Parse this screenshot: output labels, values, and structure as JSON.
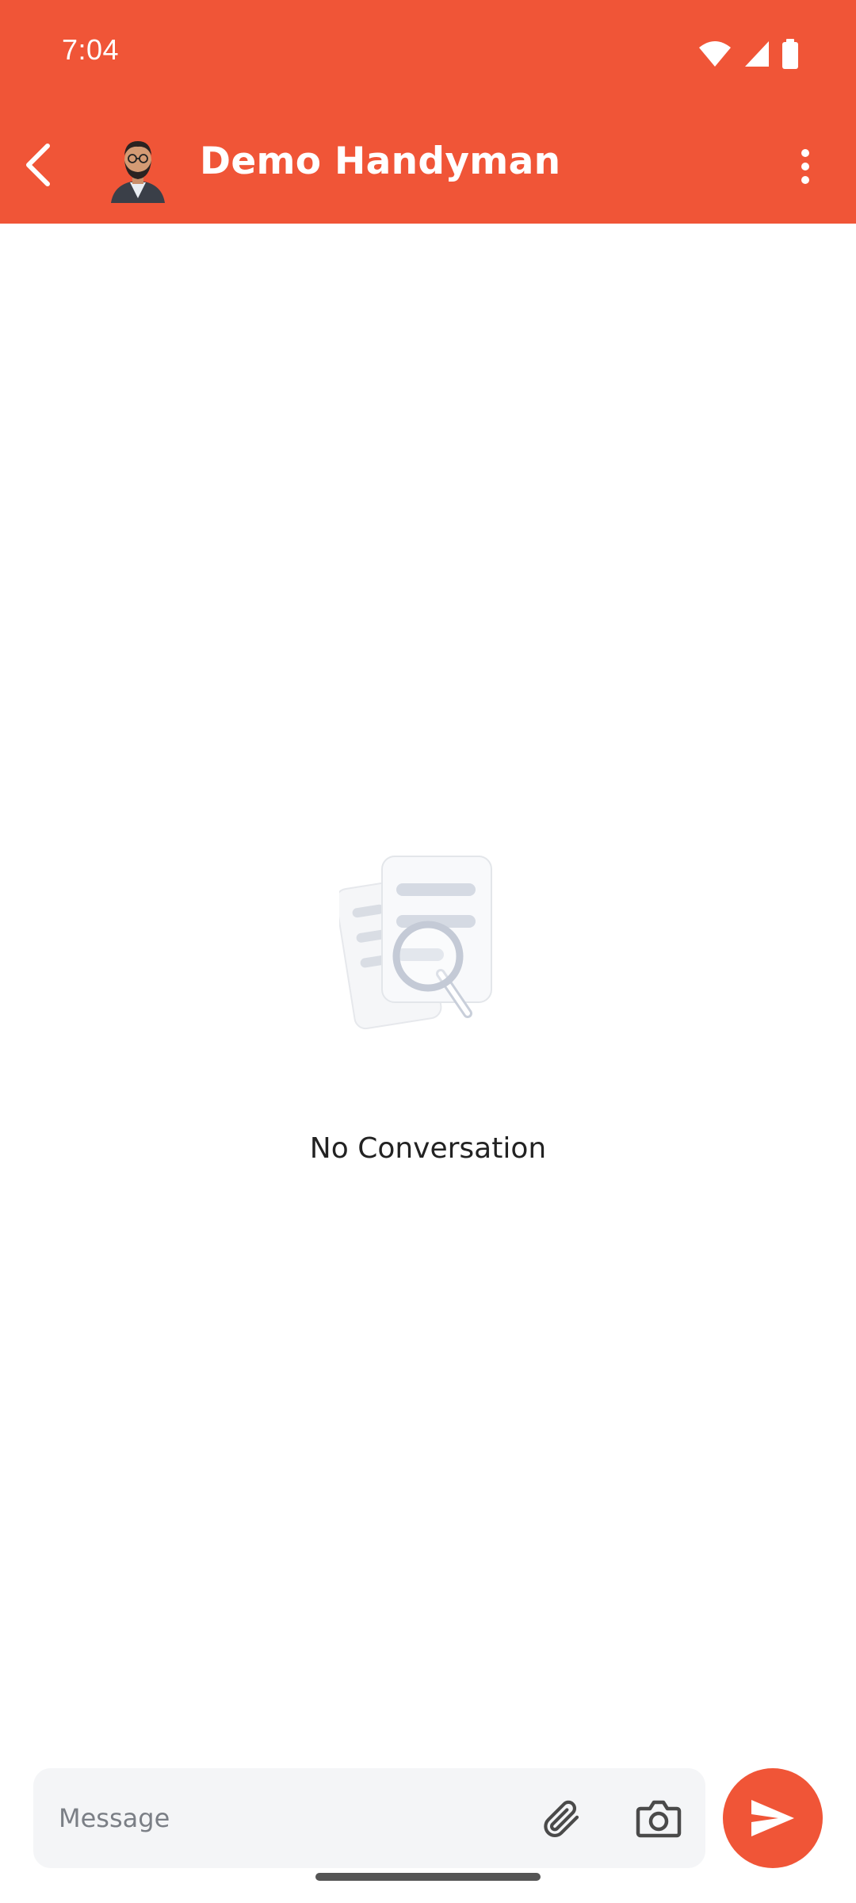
{
  "status_bar": {
    "time": "7:04",
    "icons": [
      "wifi-icon",
      "signal-icon",
      "battery-icon"
    ]
  },
  "app_bar": {
    "title": "Demo Handyman",
    "back_icon": "arrow-back-icon",
    "menu_icon": "more-vert-icon",
    "avatar": "handyman-avatar"
  },
  "empty_state": {
    "text": "No Conversation",
    "icon": "document-search-illustration"
  },
  "composer": {
    "placeholder": "Message",
    "value": "",
    "attach_icon": "paperclip-icon",
    "camera_icon": "camera-icon",
    "send_icon": "send-icon"
  },
  "colors": {
    "primary": "#F05537",
    "input_background": "#F4F5F7",
    "text": "#222222"
  }
}
